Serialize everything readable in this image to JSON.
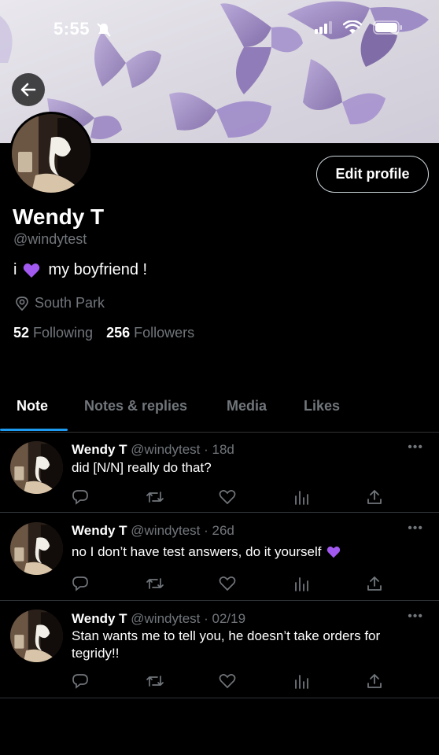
{
  "status": {
    "time": "5:55"
  },
  "profile": {
    "name": "Wendy T",
    "handle": "@windytest",
    "bio_prefix": "i",
    "bio_suffix": "my boyfriend !",
    "location": "South Park",
    "following_count": "52",
    "following_label": "Following",
    "followers_count": "256",
    "followers_label": "Followers",
    "edit_label": "Edit profile"
  },
  "tabs": [
    {
      "label": "Note"
    },
    {
      "label": "Notes & replies"
    },
    {
      "label": "Media"
    },
    {
      "label": "Likes"
    }
  ],
  "posts": [
    {
      "name": "Wendy T",
      "handle": "@windytest · 18d",
      "text": "did [N/N] really do that?"
    },
    {
      "name": "Wendy T",
      "handle": "@windytest · 26d",
      "text": "no I don’t have test answers, do it yourself"
    },
    {
      "name": "Wendy T",
      "handle": "@windytest · 02/19",
      "text": "Stan wants me to tell you, he doesn’t take orders for tegridy!!"
    }
  ],
  "colors": {
    "accent": "#1d9bf0",
    "heart": "#a259f0",
    "muted": "#71767b"
  },
  "icons": [
    "back-arrow-icon",
    "location-pin-icon",
    "reply-icon",
    "retweet-icon",
    "like-icon",
    "views-icon",
    "share-icon",
    "more-icon",
    "signal-icon",
    "wifi-icon",
    "battery-icon",
    "silent-bell-icon"
  ]
}
